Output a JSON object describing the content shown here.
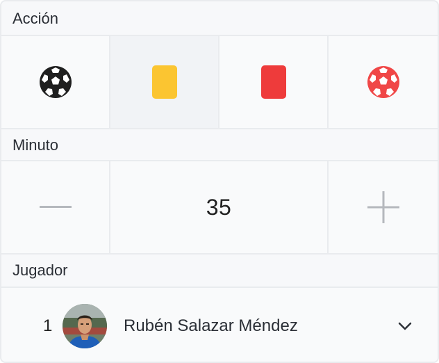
{
  "sections": {
    "action_label": "Acción",
    "minute_label": "Minuto",
    "player_label": "Jugador"
  },
  "actions": [
    {
      "name": "goal",
      "icon": "soccer-ball-icon",
      "color": "#1f1f1f",
      "selected": false
    },
    {
      "name": "yellow-card",
      "icon": "yellow-card-icon",
      "color": "#fbc531",
      "selected": true
    },
    {
      "name": "red-card",
      "icon": "red-card-icon",
      "color": "#ee3b3b",
      "selected": false
    },
    {
      "name": "own-goal",
      "icon": "soccer-ball-red-icon",
      "color": "#f04747",
      "selected": false
    }
  ],
  "minute": {
    "value": "35",
    "decrement_icon": "minus-icon",
    "increment_icon": "plus-icon"
  },
  "player": {
    "number": "1",
    "name": "Rubén Salazar Méndez",
    "dropdown_icon": "chevron-down-icon"
  },
  "colors": {
    "panel_bg": "#f7f8fa",
    "divider": "#e9ebee",
    "control_gray": "#b5b8bd"
  }
}
